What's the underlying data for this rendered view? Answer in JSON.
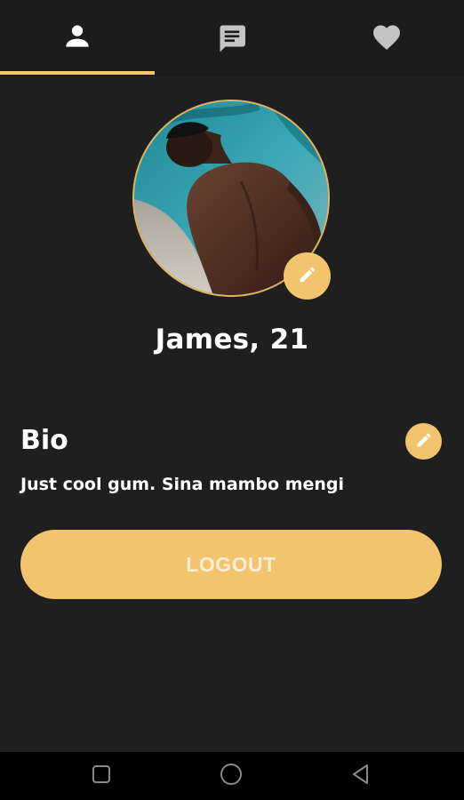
{
  "tabs": [
    {
      "icon": "person-icon",
      "active": true
    },
    {
      "icon": "chat-icon",
      "active": false
    },
    {
      "icon": "heart-icon",
      "active": false
    }
  ],
  "profile": {
    "name": "James, 21",
    "avatar_icon": "profile-photo"
  },
  "bio": {
    "heading": "Bio",
    "text": "Just cool gum. Sina mambo mengi"
  },
  "actions": {
    "logout_label": "LOGOUT"
  },
  "system_nav": {
    "items": [
      "recents-icon",
      "home-icon",
      "back-icon"
    ]
  },
  "colors": {
    "background": "#1f1f1f",
    "accent": "#f2c46d",
    "text": "#ffffff",
    "inactive_icon": "#c4c4c4"
  }
}
